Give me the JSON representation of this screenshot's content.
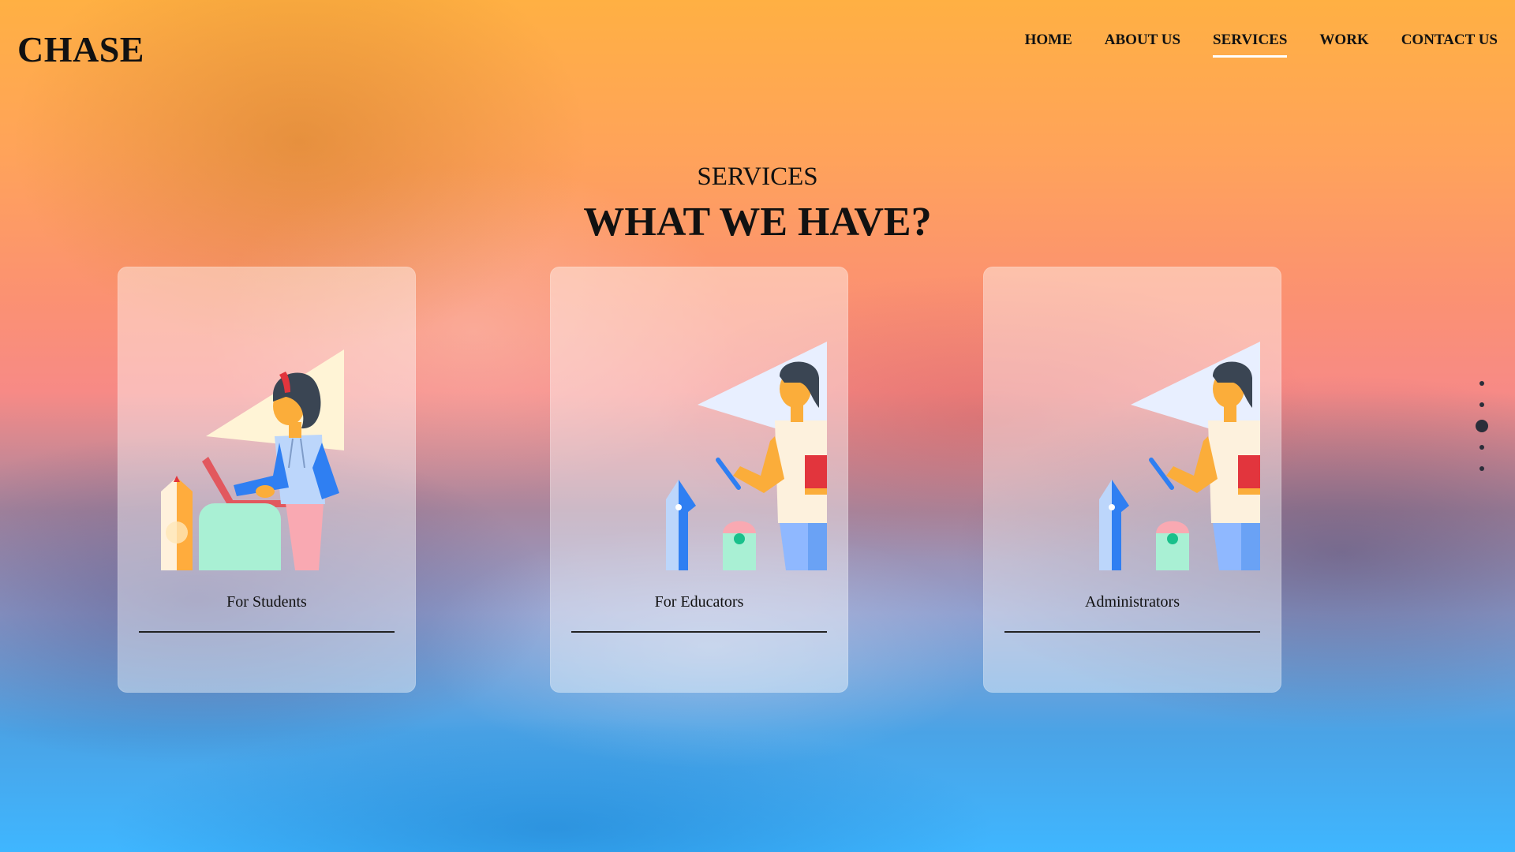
{
  "brand": {
    "logo": "CHASE"
  },
  "nav": {
    "items": [
      {
        "label": "HOME",
        "active": false
      },
      {
        "label": "ABOUT US",
        "active": false
      },
      {
        "label": "SERVICES",
        "active": true
      },
      {
        "label": "WORK",
        "active": false
      },
      {
        "label": "CONTACT US",
        "active": false
      }
    ]
  },
  "section": {
    "eyebrow": "SERVICES",
    "title": "WHAT WE HAVE?"
  },
  "cards": [
    {
      "label": "For Students",
      "illustration": "student-laptop-illustration"
    },
    {
      "label": "For Educators",
      "illustration": "educator-book-illustration"
    },
    {
      "label": "Administrators",
      "illustration": "administrator-book-illustration"
    }
  ],
  "pager": {
    "count": 5,
    "active_index": 2
  },
  "colors": {
    "accent_underline": "#ffffff",
    "text": "#111111",
    "dot": "#2a2e3a"
  }
}
